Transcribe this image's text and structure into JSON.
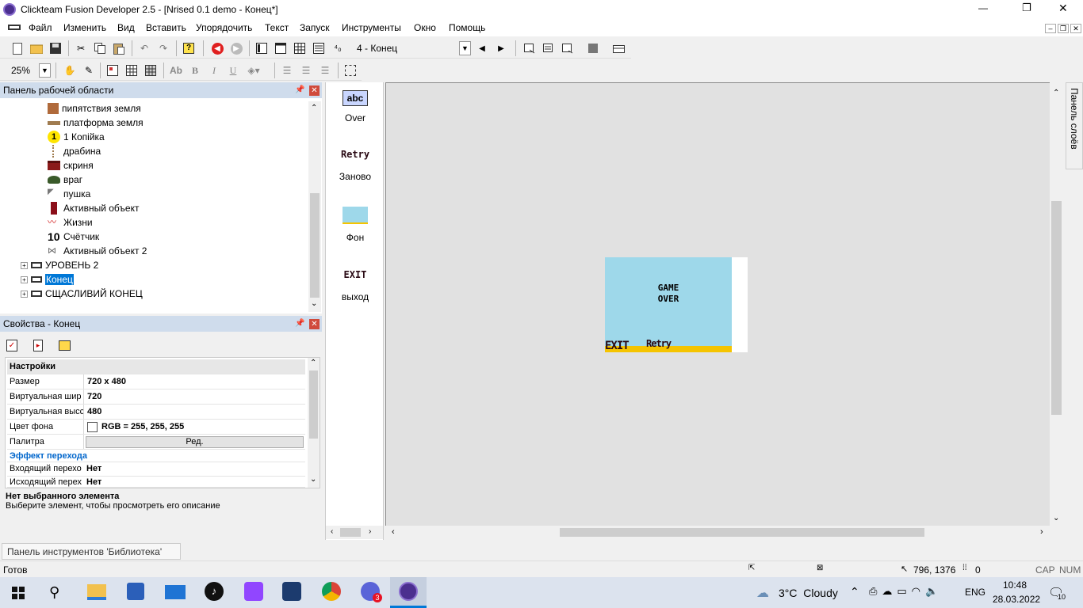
{
  "window": {
    "title": "Clickteam Fusion Developer 2.5 - [Nrised 0.1 demo - Конец*]",
    "minimize": "—",
    "maximize": "❐",
    "close": "✕"
  },
  "menu": [
    "Файл",
    "Изменить",
    "Вид",
    "Вставить",
    "Упорядочить",
    "Текст",
    "Запуск",
    "Инструменты",
    "Окно",
    "Помощь"
  ],
  "toolbar": {
    "frame_select": "4 - Конец",
    "zoom": "25%"
  },
  "workspace_panel": {
    "title": "Панель рабочей области",
    "items": [
      "пипятствия земля",
      "платформа земля",
      "1 Копійка",
      "драбина",
      "скриня",
      "враг",
      "пушка",
      "Активный объект",
      "Жизни",
      "Счётчик",
      "Активный объект 2",
      "УРОВЕНЬ 2",
      "Конец",
      "СЩАСЛИВИЙ КОНЕЦ"
    ],
    "icon_text_coin": "1",
    "icon_text_counter": "10"
  },
  "properties_panel": {
    "title": "Свойства - Конец",
    "section_settings": "Настройки",
    "rows": [
      {
        "name": "Размер",
        "value": "720 x 480"
      },
      {
        "name": "Виртуальная шир",
        "value": "720"
      },
      {
        "name": "Виртуальная высс",
        "value": "480"
      },
      {
        "name": "Цвет фона",
        "value": "RGB = 255, 255, 255"
      },
      {
        "name": "Палитра",
        "value": "Ред."
      }
    ],
    "section_transition": "Эффект перехода",
    "rows2": [
      {
        "name": "Входящий перехо",
        "value": "Нет"
      },
      {
        "name": "Исходящий перех",
        "value": "Нет"
      }
    ],
    "desc_title": "Нет выбранного элемента",
    "desc_text": "Выберите элемент, чтобы просмотреть его описание"
  },
  "library": {
    "items": [
      {
        "label": "Over",
        "icon": "abc"
      },
      {
        "label": "Заново",
        "icon": "Retry"
      },
      {
        "label": "Фон",
        "icon": ""
      },
      {
        "label": "выход",
        "icon": "EXIT"
      }
    ]
  },
  "frame": {
    "line1": "GAME",
    "line2": "OVER",
    "exit": "EXIT",
    "retry": "Retry",
    "bg_color": "#9ed8ea",
    "floor_color": "#f5c400"
  },
  "layers_tab": "Панель слоёв",
  "library_tab": "Панель инструментов 'Библиотека'",
  "status": {
    "ready": "Готов",
    "coords": "796, 1376",
    "count": "0",
    "cap": "CAP",
    "num": "NUM"
  },
  "taskbar": {
    "weather": "3°C  Cloudy",
    "lang": "ENG",
    "time": "10:48",
    "date": "28.03.2022",
    "notif": "10",
    "badge": "3"
  },
  "colors": {
    "title_bar": "#ffffff",
    "panel_header": "#cfdcec",
    "selected": "#0078d7",
    "editor_bg": "#e1e1e1",
    "taskbar": "#dce3ee"
  }
}
